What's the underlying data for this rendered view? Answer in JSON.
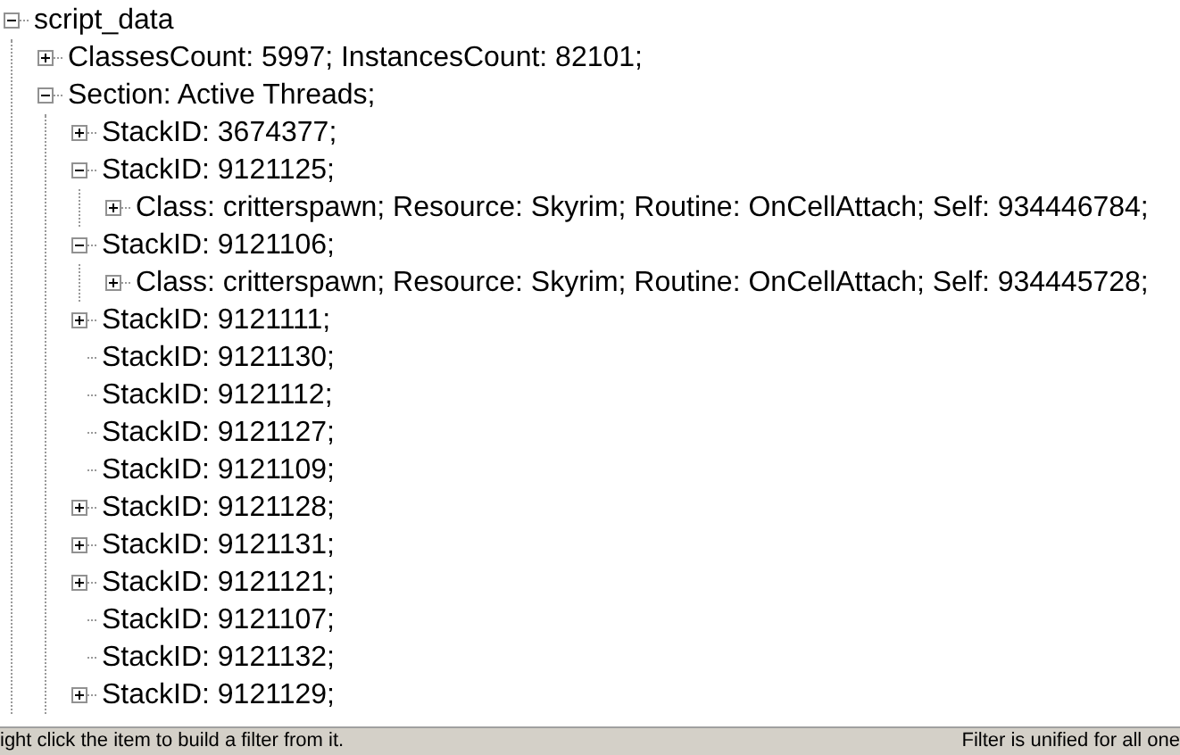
{
  "tree": [
    {
      "label": "script_data",
      "kind": "branch",
      "expanded": true,
      "children": [
        {
          "label": "ClassesCount: 5997; InstancesCount: 82101;",
          "kind": "branch",
          "expanded": false
        },
        {
          "label": "Section: Active Threads;",
          "kind": "branch",
          "expanded": true,
          "children": [
            {
              "label": "StackID: 3674377;",
              "kind": "branch",
              "expanded": false
            },
            {
              "label": "StackID: 9121125;",
              "kind": "branch",
              "expanded": true,
              "children": [
                {
                  "label": "Class: critterspawn; Resource: Skyrim; Routine: OnCellAttach; Self: 934446784;",
                  "kind": "branch",
                  "expanded": false
                }
              ]
            },
            {
              "label": "StackID: 9121106;",
              "kind": "branch",
              "expanded": true,
              "children": [
                {
                  "label": "Class: critterspawn; Resource: Skyrim; Routine: OnCellAttach; Self: 934445728;",
                  "kind": "branch",
                  "expanded": false
                }
              ]
            },
            {
              "label": "StackID: 9121111;",
              "kind": "branch",
              "expanded": false
            },
            {
              "label": "StackID: 9121130;",
              "kind": "leaf"
            },
            {
              "label": "StackID: 9121112;",
              "kind": "leaf"
            },
            {
              "label": "StackID: 9121127;",
              "kind": "leaf"
            },
            {
              "label": "StackID: 9121109;",
              "kind": "leaf"
            },
            {
              "label": "StackID: 9121128;",
              "kind": "branch",
              "expanded": false
            },
            {
              "label": "StackID: 9121131;",
              "kind": "branch",
              "expanded": false
            },
            {
              "label": "StackID: 9121121;",
              "kind": "branch",
              "expanded": false
            },
            {
              "label": "StackID: 9121107;",
              "kind": "leaf"
            },
            {
              "label": "StackID: 9121132;",
              "kind": "leaf"
            },
            {
              "label": "StackID: 9121129;",
              "kind": "branch",
              "expanded": false
            }
          ]
        }
      ]
    }
  ],
  "status_bar": {
    "left": "ight click the item to build a filter from it.",
    "right": "Filter is unified for all one"
  }
}
